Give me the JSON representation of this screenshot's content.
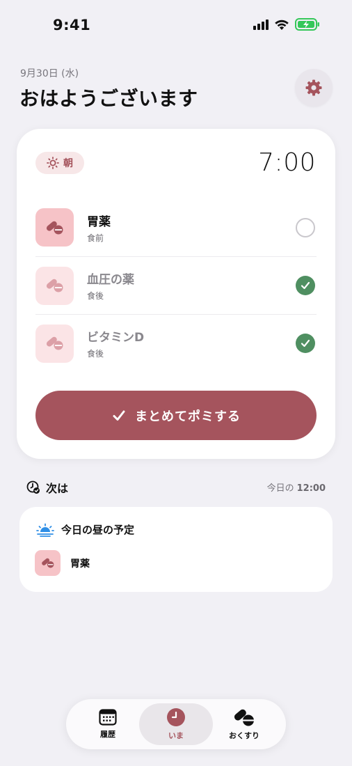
{
  "status_bar": {
    "time": "9:41"
  },
  "header": {
    "date": "9月30日 (水)",
    "greeting": "おはようございます"
  },
  "slot": {
    "badge_label": "朝",
    "time": "7:00"
  },
  "medications": [
    {
      "name": "胃薬",
      "note": "食前",
      "taken": false
    },
    {
      "name": "血圧の薬",
      "note": "食後",
      "taken": true
    },
    {
      "name": "ビタミンD",
      "note": "食後",
      "taken": true
    }
  ],
  "actions": {
    "take_all_label": "まとめてポミする"
  },
  "next": {
    "title": "次は",
    "time_prefix": "今日の",
    "time": "12:00",
    "card_title": "今日の昼の予定",
    "med_name": "胃薬"
  },
  "tabs": [
    {
      "label": "履歴",
      "active": false
    },
    {
      "label": "いま",
      "active": true
    },
    {
      "label": "おくすり",
      "active": false
    }
  ],
  "colors": {
    "accent": "#a5545d",
    "success": "#4f8f61",
    "pill_bg": "#f6c3c7",
    "background": "#f1f0f5"
  }
}
